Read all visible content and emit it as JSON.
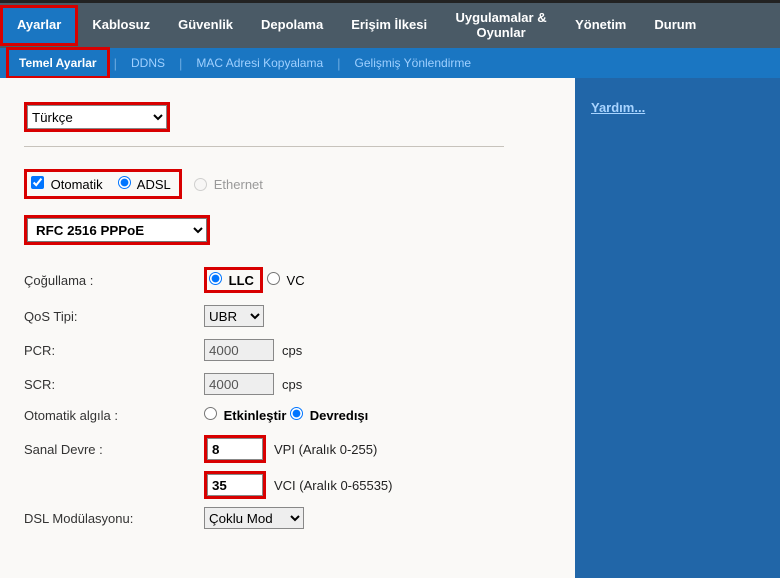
{
  "top_nav": {
    "items": [
      "Ayarlar",
      "Kablosuz",
      "Güvenlik",
      "Depolama",
      "Erişim İlkesi",
      "Uygulamalar & Oyunlar",
      "Yönetim",
      "Durum"
    ],
    "active_index": 0
  },
  "sub_nav": {
    "items": [
      "Temel Ayarlar",
      "DDNS",
      "MAC Adresi Kopyalama",
      "Gelişmiş Yönlendirme"
    ],
    "active_index": 0
  },
  "help": {
    "label": "Yardım..."
  },
  "language": {
    "selected": "Türkçe"
  },
  "connection": {
    "auto_label": "Otomatik",
    "auto_checked": true,
    "adsl_label": "ADSL",
    "eth_label": "Ethernet",
    "type_selected": "adsl"
  },
  "encapsulation": {
    "selected": "RFC 2516 PPPoE"
  },
  "mux": {
    "label": "Çoğullama :",
    "llc": "LLC",
    "vc": "VC",
    "selected": "llc"
  },
  "qos": {
    "label": "QoS Tipi:",
    "selected": "UBR"
  },
  "pcr": {
    "label": "PCR:",
    "value": "4000",
    "unit": "cps"
  },
  "scr": {
    "label": "SCR:",
    "value": "4000",
    "unit": "cps"
  },
  "autodetect": {
    "label": "Otomatik algıla :",
    "enable": "Etkinleştir",
    "disable": "Devredışı",
    "selected": "disable"
  },
  "vc": {
    "label": "Sanal Devre :",
    "vpi": "8",
    "vpi_hint": "VPI (Aralık 0-255)",
    "vci": "35",
    "vci_hint": "VCI (Aralık 0-65535)"
  },
  "dsl_mod": {
    "label": "DSL Modülasyonu:",
    "selected": "Çoklu Mod"
  }
}
